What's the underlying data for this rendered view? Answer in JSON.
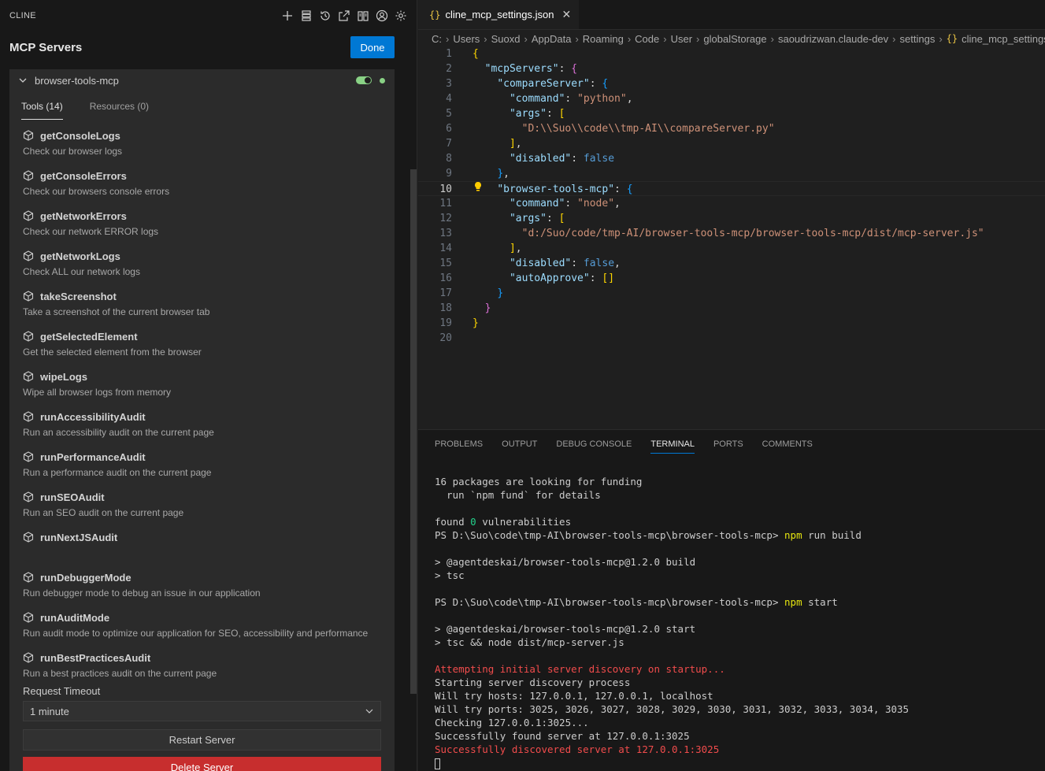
{
  "sidebar": {
    "brand": "CLINE",
    "icons": [
      "plus-icon",
      "server-stack-icon",
      "history-icon",
      "popout-icon",
      "book-icon",
      "account-icon",
      "gear-icon"
    ],
    "title": "MCP Servers",
    "done_label": "Done",
    "server": {
      "name": "browser-tools-mcp",
      "enabled": true,
      "status_color": "#89d185"
    },
    "tabs": [
      "Tools (14)",
      "Resources (0)"
    ],
    "active_tab": "Tools (14)",
    "tools": [
      {
        "name": "getConsoleLogs",
        "desc": "Check our browser logs"
      },
      {
        "name": "getConsoleErrors",
        "desc": "Check our browsers console errors"
      },
      {
        "name": "getNetworkErrors",
        "desc": "Check our network ERROR logs"
      },
      {
        "name": "getNetworkLogs",
        "desc": "Check ALL our network logs"
      },
      {
        "name": "takeScreenshot",
        "desc": "Take a screenshot of the current browser tab"
      },
      {
        "name": "getSelectedElement",
        "desc": "Get the selected element from the browser"
      },
      {
        "name": "wipeLogs",
        "desc": "Wipe all browser logs from memory"
      },
      {
        "name": "runAccessibilityAudit",
        "desc": "Run an accessibility audit on the current page"
      },
      {
        "name": "runPerformanceAudit",
        "desc": "Run a performance audit on the current page"
      },
      {
        "name": "runSEOAudit",
        "desc": "Run an SEO audit on the current page"
      },
      {
        "name": "runNextJSAudit",
        "desc": ""
      },
      {
        "name": "runDebuggerMode",
        "desc": "Run debugger mode to debug an issue in our application"
      },
      {
        "name": "runAuditMode",
        "desc": "Run audit mode to optimize our application for SEO, accessibility and performance"
      },
      {
        "name": "runBestPracticesAudit",
        "desc": "Run a best practices audit on the current page"
      }
    ],
    "timeout_label": "Request Timeout",
    "timeout_value": "1 minute",
    "restart_label": "Restart Server",
    "delete_label": "Delete Server"
  },
  "editor": {
    "tab_name": "cline_mcp_settings.json",
    "breadcrumb": [
      "C:",
      "Users",
      "Suoxd",
      "AppData",
      "Roaming",
      "Code",
      "User",
      "globalStorage",
      "saoudrizwan.claude-dev",
      "settings"
    ],
    "breadcrumb_file": "cline_mcp_settings.json",
    "current_line": 10,
    "lines": [
      "{",
      "  \"mcpServers\": {",
      "    \"compareServer\": {",
      "      \"command\": \"python\",",
      "      \"args\": [",
      "        \"D:\\\\Suo\\\\code\\\\tmp-AI\\\\compareServer.py\"",
      "      ],",
      "      \"disabled\": false",
      "    },",
      "    \"browser-tools-mcp\": {",
      "      \"command\": \"node\",",
      "      \"args\": [",
      "        \"d:/Suo/code/tmp-AI/browser-tools-mcp/browser-tools-mcp/dist/mcp-server.js\"",
      "      ],",
      "      \"disabled\": false,",
      "      \"autoApprove\": []",
      "    }",
      "  }",
      "}",
      ""
    ]
  },
  "panel": {
    "tabs": [
      "PROBLEMS",
      "OUTPUT",
      "DEBUG CONSOLE",
      "TERMINAL",
      "PORTS",
      "COMMENTS"
    ],
    "active_tab": "TERMINAL",
    "terminal": [
      {
        "text": "16 packages are looking for funding",
        "color": "default"
      },
      {
        "text": "  run `npm fund` for details",
        "color": "default"
      },
      {
        "text": "",
        "color": "default"
      },
      {
        "text": "found 0 vulnerabilities",
        "color": "default"
      },
      {
        "text": "PS D:\\Suo\\code\\tmp-AI\\browser-tools-mcp\\browser-tools-mcp> npm run build",
        "color": "prompt"
      },
      {
        "text": "",
        "color": "default"
      },
      {
        "text": "> @agentdeskai/browser-tools-mcp@1.2.0 build",
        "color": "default"
      },
      {
        "text": "> tsc",
        "color": "default"
      },
      {
        "text": "",
        "color": "default"
      },
      {
        "text": "PS D:\\Suo\\code\\tmp-AI\\browser-tools-mcp\\browser-tools-mcp> npm start",
        "color": "prompt"
      },
      {
        "text": "",
        "color": "default"
      },
      {
        "text": "> @agentdeskai/browser-tools-mcp@1.2.0 start",
        "color": "default"
      },
      {
        "text": "> tsc && node dist/mcp-server.js",
        "color": "default"
      },
      {
        "text": "",
        "color": "default"
      },
      {
        "text": "Attempting initial server discovery on startup...",
        "color": "red"
      },
      {
        "text": "Starting server discovery process",
        "color": "default"
      },
      {
        "text": "Will try hosts: 127.0.0.1, 127.0.0.1, localhost",
        "color": "default"
      },
      {
        "text": "Will try ports: 3025, 3026, 3027, 3028, 3029, 3030, 3031, 3032, 3033, 3034, 3035",
        "color": "default"
      },
      {
        "text": "Checking 127.0.0.1:3025...",
        "color": "default"
      },
      {
        "text": "Successfully found server at 127.0.0.1:3025",
        "color": "default"
      },
      {
        "text": "Successfully discovered server at 127.0.0.1:3025",
        "color": "red"
      }
    ]
  },
  "colors": {
    "accent": "#0078d4",
    "delete": "#c72e2e",
    "error_text": "#f14c4c",
    "status_ok": "#89d185"
  }
}
